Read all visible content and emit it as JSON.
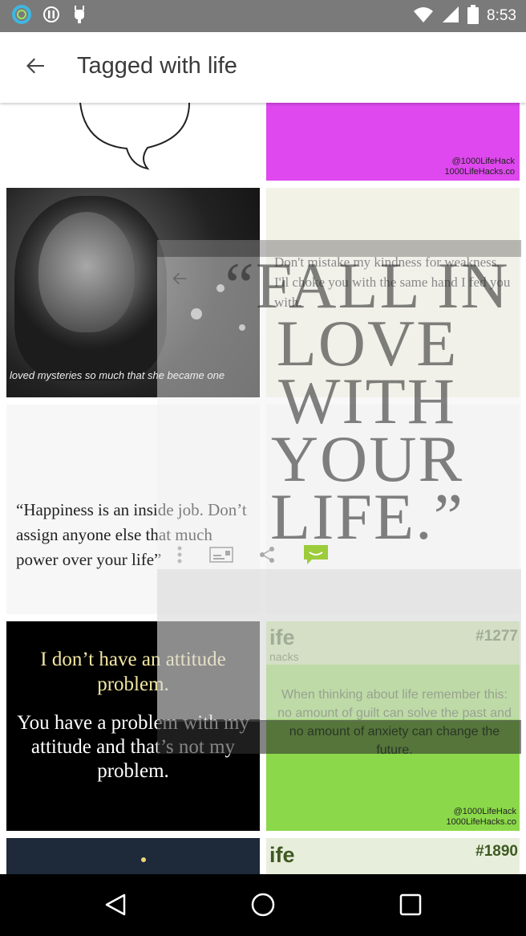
{
  "status_bar": {
    "time": "8:53",
    "left_icons": [
      "app-ring-icon",
      "sync-icon",
      "android-icon"
    ],
    "right_icons": [
      "wifi-icon",
      "signal-icon",
      "battery-icon"
    ]
  },
  "app_bar": {
    "title": "Tagged with life",
    "back_icon": "arrow-back-icon"
  },
  "tiles": {
    "magenta": {
      "watermark_1": "@1000LifeHack",
      "watermark_2": "1000LifeHacks.co"
    },
    "photo": {
      "caption": "loved mysteries so much that she became one"
    },
    "kindness": {
      "quote": "Don't mistake my kindness for weakness. I'll choke you with the same hand I fed you with."
    },
    "happiness": {
      "quote": "“Happiness is an inside job. Don’t assign anyone else that much power over your life”"
    },
    "attitude": {
      "line_1": "I don’t have an attitude problem.",
      "line_2": "You have a problem with my attitude and that’s not my problem."
    },
    "green": {
      "logo": "ife",
      "logo_sub": "nacks",
      "number": "#1277",
      "text": "When thinking about life remember this: no amount of guilt can solve the past and no amount of anxiety can change the future.",
      "watermark_1": "@1000LifeHack",
      "watermark_2": "1000LifeHacks.co"
    },
    "red": {
      "logo": "ife",
      "number": "#1890"
    }
  },
  "overlay": {
    "big_text": "“FALL IN LOVE WITH YOUR LIFE.”",
    "actions": [
      "more-icon",
      "slideshow-icon",
      "share-icon",
      "comment-icon"
    ]
  },
  "nav_bar": {
    "buttons": [
      "back-triangle-icon",
      "home-circle-icon",
      "recents-square-icon"
    ]
  },
  "colors": {
    "status_bar": "#7a7a7a",
    "magenta": "#de48ee",
    "green": "#8bd94a",
    "comment_green": "#9ccc3c"
  }
}
